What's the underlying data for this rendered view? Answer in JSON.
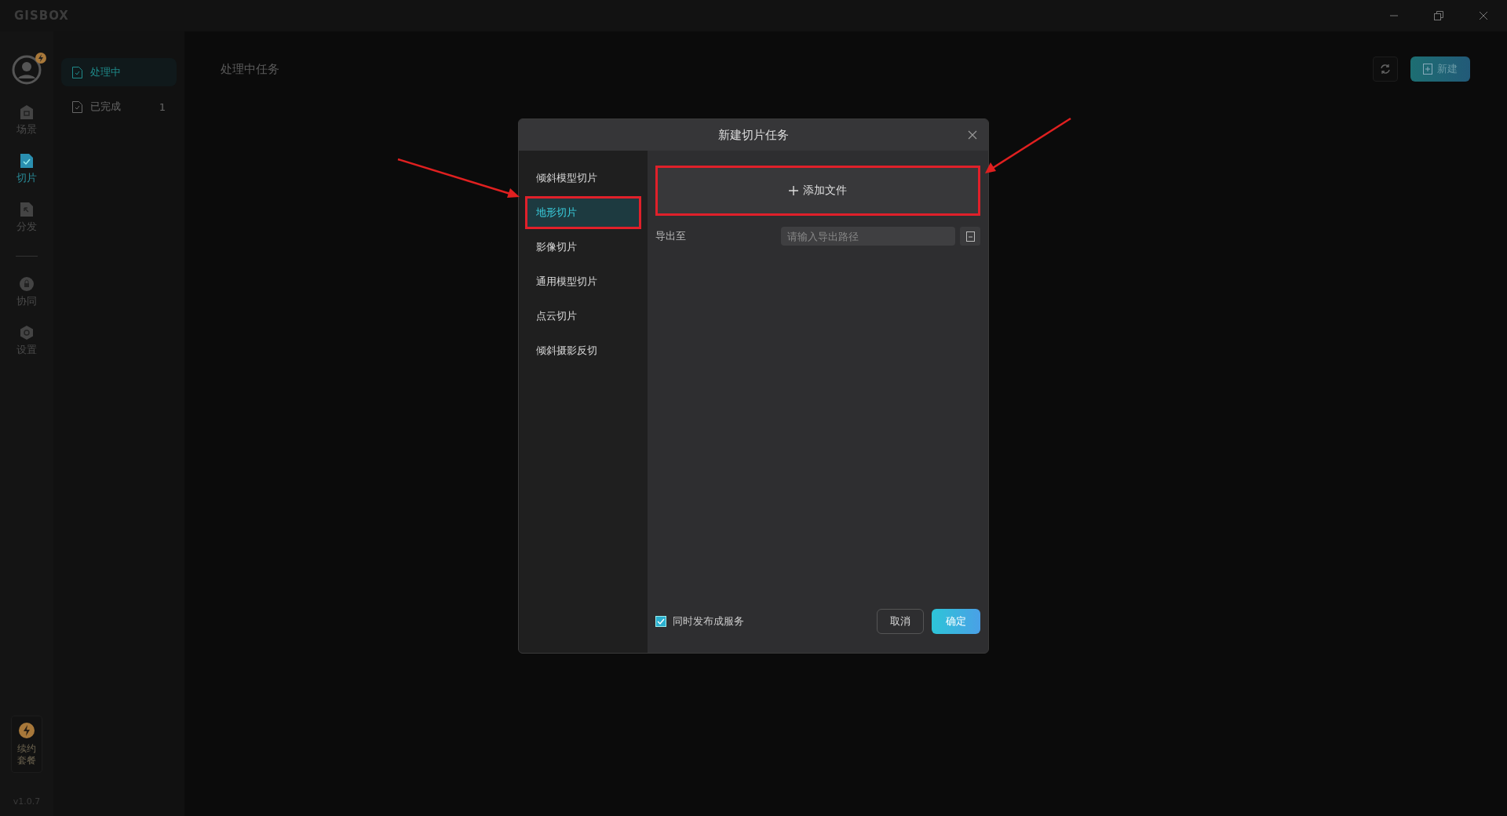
{
  "app": {
    "logo": "GISBOX"
  },
  "rail": {
    "groups": [
      [
        {
          "label": "场景",
          "kind": "scene",
          "selected": false
        },
        {
          "label": "切片",
          "kind": "slice",
          "selected": true
        },
        {
          "label": "分发",
          "kind": "distribute",
          "selected": false
        }
      ],
      [
        {
          "label": "协同",
          "kind": "collab",
          "selected": false
        },
        {
          "label": "设置",
          "kind": "settings",
          "selected": false
        }
      ]
    ],
    "renew": "续约套餐",
    "version": "v1.0.7"
  },
  "task_nav": [
    {
      "label": "处理中",
      "selected": true
    },
    {
      "label": "已完成",
      "count": "1",
      "selected": false
    }
  ],
  "main": {
    "title": "处理中任务",
    "new_button": "新建"
  },
  "dialog": {
    "title": "新建切片任务",
    "menu": [
      {
        "label": "倾斜模型切片",
        "selected": false
      },
      {
        "label": "地形切片",
        "selected": true
      },
      {
        "label": "影像切片",
        "selected": false
      },
      {
        "label": "通用模型切片",
        "selected": false
      },
      {
        "label": "点云切片",
        "selected": false
      },
      {
        "label": "倾斜摄影反切",
        "selected": false
      }
    ],
    "add_file": "添加文件",
    "export": {
      "label": "导出至",
      "placeholder": "请输入导出路径"
    },
    "publish": {
      "label": "同时发布成服务",
      "checked": true
    },
    "cancel": "取消",
    "ok": "确定"
  }
}
